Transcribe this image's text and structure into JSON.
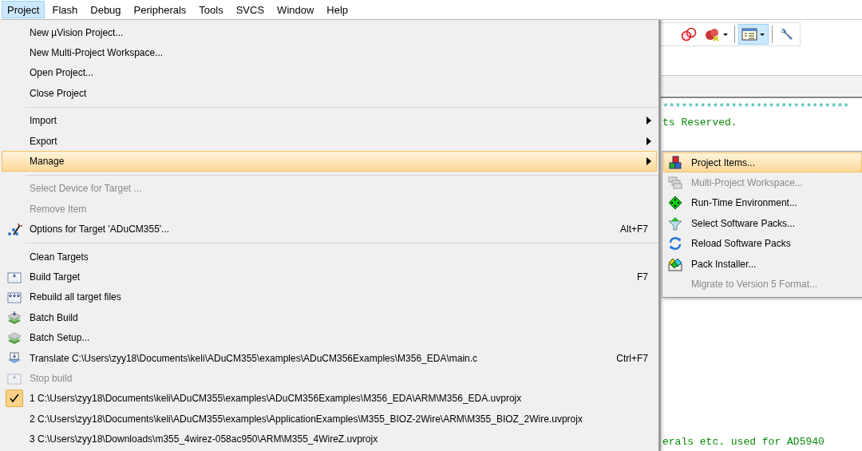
{
  "menu_bar": [
    {
      "label": "Project",
      "selected": true
    },
    {
      "label": "Flash",
      "selected": false
    },
    {
      "label": "Debug",
      "selected": false
    },
    {
      "label": "Peripherals",
      "selected": false
    },
    {
      "label": "Tools",
      "selected": false
    },
    {
      "label": "SVCS",
      "selected": false
    },
    {
      "label": "Window",
      "selected": false
    },
    {
      "label": "Help",
      "selected": false
    }
  ],
  "toolbar": [
    {
      "kind": "rings",
      "selected": false
    },
    {
      "kind": "blob-dropdown",
      "selected": false
    },
    {
      "kind": "window-dropdown",
      "selected": true
    },
    {
      "kind": "wrench",
      "selected": false
    }
  ],
  "editor": {
    "top_lines": [
      {
        "kind": "stars",
        "text": "******************************"
      },
      {
        "kind": "comment",
        "text": "ts Reserved."
      }
    ],
    "bottom_line": "erals etc. used for AD5940"
  },
  "project_menu": [
    {
      "kind": "plain",
      "label": "New µVision Project...",
      "submenu": false,
      "disabled": false,
      "selected": false,
      "checked": false
    },
    {
      "kind": "plain",
      "label": "New Multi-Project Workspace...",
      "submenu": false,
      "disabled": false,
      "selected": false,
      "checked": false
    },
    {
      "kind": "plain",
      "label": "Open Project...",
      "submenu": false,
      "disabled": false,
      "selected": false,
      "checked": false
    },
    {
      "kind": "plain",
      "label": "Close Project",
      "submenu": false,
      "disabled": false,
      "selected": false,
      "checked": false
    },
    {
      "kind": "separator"
    },
    {
      "kind": "plain",
      "label": "Import",
      "submenu": true,
      "disabled": false,
      "selected": false,
      "checked": false
    },
    {
      "kind": "plain",
      "label": "Export",
      "submenu": true,
      "disabled": false,
      "selected": false,
      "checked": false
    },
    {
      "kind": "plain",
      "label": "Manage",
      "submenu": true,
      "disabled": false,
      "selected": true,
      "checked": false
    },
    {
      "kind": "separator"
    },
    {
      "kind": "plain",
      "label": "Select Device for Target ...",
      "submenu": false,
      "disabled": true,
      "selected": false,
      "checked": false
    },
    {
      "kind": "plain",
      "label": "Remove Item",
      "submenu": false,
      "disabled": true,
      "selected": false,
      "checked": false
    },
    {
      "kind": "options",
      "label": "Options for Target 'ADuCM355'...",
      "shortcut": "Alt+F7",
      "submenu": false,
      "disabled": false,
      "selected": false,
      "checked": false
    },
    {
      "kind": "separator"
    },
    {
      "kind": "plain",
      "label": "Clean Targets",
      "submenu": false,
      "disabled": false,
      "selected": false,
      "checked": false
    },
    {
      "kind": "build",
      "label": "Build Target",
      "shortcut": "F7",
      "submenu": false,
      "disabled": false,
      "selected": false,
      "checked": false
    },
    {
      "kind": "rebuild",
      "label": "Rebuild all target files",
      "submenu": false,
      "disabled": false,
      "selected": false,
      "checked": false
    },
    {
      "kind": "batch-build",
      "label": "Batch Build",
      "submenu": false,
      "disabled": false,
      "selected": false,
      "checked": false
    },
    {
      "kind": "batch-setup",
      "label": "Batch Setup...",
      "submenu": false,
      "disabled": false,
      "selected": false,
      "checked": false
    },
    {
      "kind": "translate",
      "label": "Translate C:\\Users\\zyy18\\Documents\\keli\\ADuCM355\\examples\\ADuCM356Examples\\M356_EDA\\main.c",
      "shortcut": "Ctrl+F7",
      "submenu": false,
      "disabled": false,
      "selected": false,
      "checked": false
    },
    {
      "kind": "stop",
      "label": "Stop build",
      "submenu": false,
      "disabled": true,
      "selected": false,
      "checked": false
    },
    {
      "kind": "plain",
      "label": "1 C:\\Users\\zyy18\\Documents\\keli\\ADuCM355\\examples\\ADuCM356Examples\\M356_EDA\\ARM\\M356_EDA.uvprojx",
      "submenu": false,
      "disabled": false,
      "selected": false,
      "checked": true
    },
    {
      "kind": "plain",
      "label": "2 C:\\Users\\zyy18\\Documents\\keli\\ADuCM355\\examples\\ApplicationExamples\\M355_BIOZ-2Wire\\ARM\\M355_BIOZ_2Wire.uvprojx",
      "submenu": false,
      "disabled": false,
      "selected": false,
      "checked": false
    },
    {
      "kind": "plain",
      "label": "3 C:\\Users\\zyy18\\Downloads\\m355_4wirez-058ac950\\ARM\\M355_4WireZ.uvprojx",
      "submenu": false,
      "disabled": false,
      "selected": false,
      "checked": false
    }
  ],
  "manage_submenu": [
    {
      "kind": "project-items",
      "label": "Project Items...",
      "disabled": false,
      "selected": true
    },
    {
      "kind": "workspace",
      "label": "Multi-Project Workspace...",
      "disabled": true,
      "selected": false
    },
    {
      "kind": "rte",
      "label": "Run-Time Environment...",
      "disabled": false,
      "selected": false
    },
    {
      "kind": "select-packs",
      "label": "Select Software Packs...",
      "disabled": false,
      "selected": false
    },
    {
      "kind": "reload",
      "label": "Reload Software Packs",
      "disabled": false,
      "selected": false
    },
    {
      "kind": "installer",
      "label": "Pack Installer...",
      "disabled": false,
      "selected": false
    },
    {
      "kind": "plain",
      "label": "Migrate to Version 5 Format...",
      "disabled": true,
      "selected": false
    }
  ]
}
